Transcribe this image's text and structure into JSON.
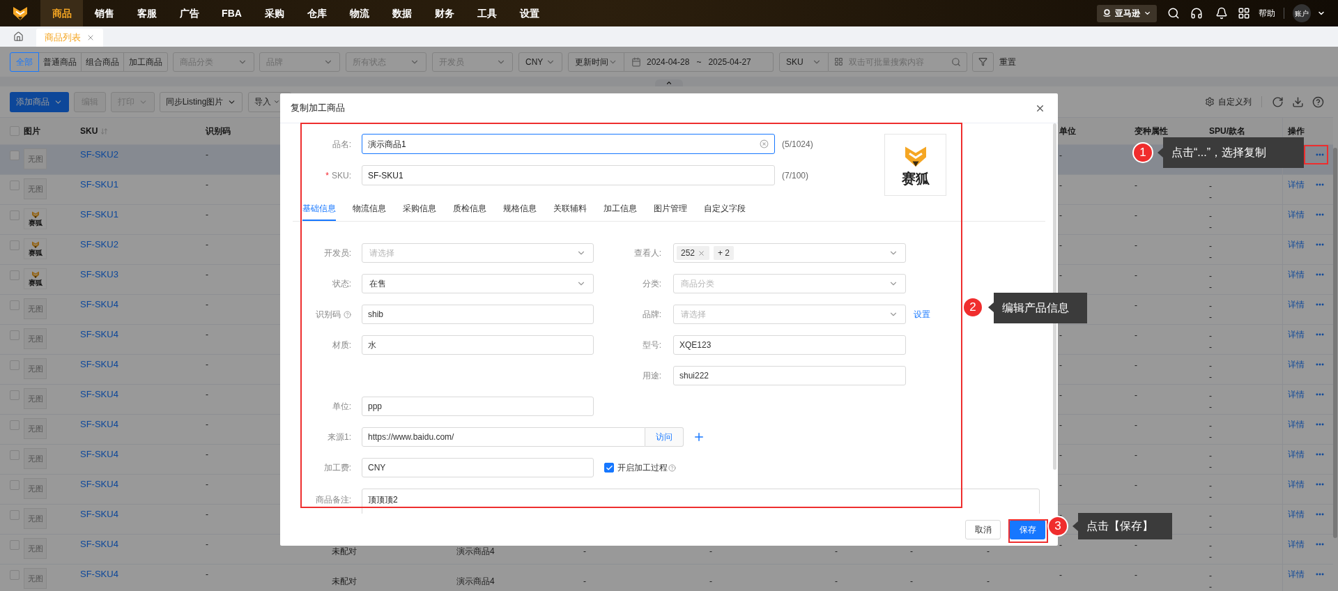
{
  "top_nav": {
    "items": [
      {
        "label": "商品",
        "selected": true
      },
      {
        "label": "销售",
        "selected": false
      },
      {
        "label": "客服",
        "selected": false
      },
      {
        "label": "广告",
        "selected": false
      },
      {
        "label": "FBA",
        "selected": false
      },
      {
        "label": "采购",
        "selected": false
      },
      {
        "label": "仓库",
        "selected": false
      },
      {
        "label": "物流",
        "selected": false
      },
      {
        "label": "数据",
        "selected": false
      },
      {
        "label": "财务",
        "selected": false
      },
      {
        "label": "工具",
        "selected": false
      },
      {
        "label": "设置",
        "selected": false
      }
    ],
    "store": "亚马逊",
    "help": "帮助",
    "account": "账户"
  },
  "page_tabs": [
    {
      "label": "商品列表",
      "selected": true
    }
  ],
  "filters": {
    "types": [
      {
        "label": "全部",
        "selected": true
      },
      {
        "label": "普通商品",
        "selected": false
      },
      {
        "label": "组合商品",
        "selected": false
      },
      {
        "label": "加工商品",
        "selected": false
      }
    ],
    "selects": [
      {
        "placeholder": "商品分类"
      },
      {
        "placeholder": "品牌"
      },
      {
        "placeholder": "所有状态"
      },
      {
        "placeholder": "开发员"
      },
      {
        "value": "CNY"
      }
    ],
    "date": {
      "field": "更新时间",
      "start": "2024-04-28",
      "separator": "~",
      "end": "2025-04-27"
    },
    "search": {
      "field": "SKU",
      "placeholder": "双击可批量搜索内容"
    },
    "reset": "重置"
  },
  "toolbar": {
    "buttons": [
      {
        "label": "添加商品",
        "kind": "primary",
        "dropdown": true
      },
      {
        "label": "编辑",
        "kind": "disabled",
        "dropdown": false
      },
      {
        "label": "打印",
        "kind": "disabled",
        "dropdown": true
      },
      {
        "label": "同步Listing图片",
        "kind": "default",
        "dropdown": true
      },
      {
        "label": "导入",
        "kind": "default",
        "dropdown": true
      }
    ],
    "customize": "自定义列"
  },
  "table": {
    "header_checked": false,
    "columns": [
      "图片",
      "SKU",
      "识别码",
      "单位",
      "变种属性",
      "SPU/款名",
      "操作"
    ],
    "rows": [
      {
        "checked": false,
        "highlighted": true,
        "image": {
          "kind": "none",
          "text": "无图"
        },
        "sku": "SF-SKU2",
        "code": "-",
        "unit": "-"
      },
      {
        "checked": false,
        "highlighted": false,
        "image": {
          "kind": "none",
          "text": "无图"
        },
        "sku": "SF-SKU1",
        "code": "-",
        "unit": "-",
        "variant": "-",
        "spu": [
          "-",
          "-"
        ],
        "detail": "详情"
      },
      {
        "checked": false,
        "highlighted": false,
        "image": {
          "kind": "logo",
          "text": "赛狐"
        },
        "sku": "SF-SKU1",
        "code": "-",
        "unit": "-",
        "variant": "-",
        "spu": [
          "-",
          "-"
        ],
        "detail": "详情"
      },
      {
        "checked": false,
        "highlighted": false,
        "image": {
          "kind": "logo",
          "text": "赛狐"
        },
        "sku": "SF-SKU2",
        "code": "-",
        "unit": "-",
        "variant": "-",
        "spu": [
          "-",
          "-"
        ],
        "detail": "详情"
      },
      {
        "checked": false,
        "highlighted": false,
        "image": {
          "kind": "logo",
          "text": "赛狐"
        },
        "sku": "SF-SKU3",
        "code": "-",
        "unit": "-",
        "variant": "-",
        "spu": [
          "-",
          "-"
        ],
        "detail": "详情"
      },
      {
        "checked": false,
        "highlighted": false,
        "image": {
          "kind": "none",
          "text": "无图"
        },
        "sku": "SF-SKU4",
        "code": "-",
        "variant": "-",
        "spu": [
          "-",
          "-"
        ],
        "detail": "详情"
      },
      {
        "checked": false,
        "highlighted": false,
        "image": {
          "kind": "none",
          "text": "无图"
        },
        "sku": "SF-SKU4",
        "code": "-",
        "unit": "-",
        "variant": "-",
        "spu": [
          "-",
          "-"
        ],
        "detail": "详情"
      },
      {
        "checked": false,
        "highlighted": false,
        "image": {
          "kind": "none",
          "text": "无图"
        },
        "sku": "SF-SKU4",
        "code": "-",
        "unit": "-",
        "variant": "-",
        "spu": [
          "-",
          "-"
        ],
        "detail": "详情"
      },
      {
        "checked": false,
        "highlighted": false,
        "image": {
          "kind": "none",
          "text": "无图"
        },
        "sku": "SF-SKU4",
        "code": "-",
        "unit": "-",
        "variant": "-",
        "spu": [
          "-",
          "-"
        ],
        "detail": "详情"
      },
      {
        "checked": false,
        "highlighted": false,
        "image": {
          "kind": "none",
          "text": "无图"
        },
        "sku": "SF-SKU4",
        "code": "-",
        "unit": "-",
        "variant": "-",
        "spu": [
          "-",
          "-"
        ],
        "detail": "详情"
      },
      {
        "checked": false,
        "highlighted": false,
        "image": {
          "kind": "none",
          "text": "无图"
        },
        "sku": "SF-SKU4",
        "code": "-",
        "unit": "-",
        "variant": "-",
        "spu": [
          "-",
          "-"
        ],
        "detail": "详情"
      },
      {
        "checked": false,
        "highlighted": false,
        "image": {
          "kind": "none",
          "text": "无图"
        },
        "sku": "SF-SKU4",
        "code": "-",
        "unit": "-",
        "variant": "-",
        "spu": [
          "-",
          "-"
        ],
        "detail": "详情"
      },
      {
        "checked": false,
        "highlighted": false,
        "image": {
          "kind": "none",
          "text": "无图"
        },
        "sku": "SF-SKU4",
        "code": "-",
        "unit": "-",
        "spu": [
          "-",
          "-"
        ],
        "detail": "详情"
      },
      {
        "checked": false,
        "highlighted": false,
        "image": {
          "kind": "none",
          "text": "无图"
        },
        "sku": "SF-SKU4",
        "code": "-",
        "extra": [
          "未配对",
          "演示商品4",
          "-",
          "-",
          "-",
          "-",
          "-"
        ],
        "unit": "-",
        "variant": "-",
        "spu": [
          "-",
          "-"
        ],
        "detail": "详情"
      },
      {
        "checked": false,
        "highlighted": false,
        "image": {
          "kind": "none",
          "text": "无图"
        },
        "sku": "SF-SKU4",
        "code": "-",
        "extra": [
          "未配对",
          "演示商品4",
          "-",
          "-",
          "-",
          "-",
          "-"
        ],
        "unit": "-",
        "variant": "-",
        "spu": [
          "-",
          "-"
        ],
        "detail": "详情"
      }
    ]
  },
  "modal": {
    "title": "复制加工商品",
    "name": {
      "label": "品名:",
      "value": "演示商品1",
      "count": "(5/1024)",
      "focused": true
    },
    "sku": {
      "label": "SKU:",
      "required_mark": "*",
      "value": "SF-SKU1",
      "count": "(7/100)",
      "focused": false
    },
    "logo": {
      "text": "赛狐"
    },
    "tabs": [
      {
        "label": "基础信息",
        "selected": true
      },
      {
        "label": "物流信息",
        "selected": false
      },
      {
        "label": "采购信息",
        "selected": false
      },
      {
        "label": "质检信息",
        "selected": false
      },
      {
        "label": "规格信息",
        "selected": false
      },
      {
        "label": "关联辅料",
        "selected": false
      },
      {
        "label": "加工信息",
        "selected": false
      },
      {
        "label": "图片管理",
        "selected": false
      },
      {
        "label": "自定义字段",
        "selected": false
      }
    ],
    "form_rows": [
      {
        "left": {
          "kind": "select",
          "label": "开发员:",
          "placeholder": "请选择"
        },
        "right": {
          "kind": "tags",
          "label": "查看人:",
          "tags": [
            {
              "text": "252",
              "removable": true
            },
            {
              "text": "+ 2",
              "removable": false
            }
          ]
        }
      },
      {
        "left": {
          "kind": "select",
          "label": "状态:",
          "value": "在售"
        },
        "right": {
          "kind": "select",
          "label": "分类:",
          "placeholder": "商品分类"
        }
      },
      {
        "left": {
          "kind": "input",
          "label": "识别码",
          "help": true,
          "value": "shib"
        },
        "right": {
          "kind": "select",
          "label": "品牌:",
          "placeholder": "请选择",
          "link": "设置"
        }
      },
      {
        "left": {
          "kind": "input",
          "label": "材质:",
          "value": "水"
        },
        "right": {
          "kind": "input",
          "label": "型号:",
          "value": "XQE123"
        }
      },
      {
        "right": {
          "kind": "input",
          "label": "用途:",
          "value": "shui222"
        }
      },
      {
        "left": {
          "kind": "input",
          "label": "单位:",
          "value": "ppp"
        }
      },
      {
        "left": {
          "kind": "url",
          "label": "来源1:",
          "value": "https://www.baidu.com/",
          "addon": "访问"
        }
      },
      {
        "left": {
          "kind": "input",
          "label": "加工费:",
          "value": "CNY",
          "checkbox": {
            "label": "开启加工过程",
            "checked": true,
            "help": true
          }
        }
      }
    ],
    "remark": {
      "label": "商品备注:",
      "value": "顶顶顶2"
    },
    "buttons": [
      {
        "label": "取消",
        "kind": "default"
      },
      {
        "label": "保存",
        "kind": "primary"
      }
    ]
  },
  "annotations": [
    {
      "number": "1",
      "text": "点击“...”，选择复制"
    },
    {
      "number": "2",
      "text": "编辑产品信息"
    },
    {
      "number": "3",
      "text": "点击【保存】"
    }
  ]
}
